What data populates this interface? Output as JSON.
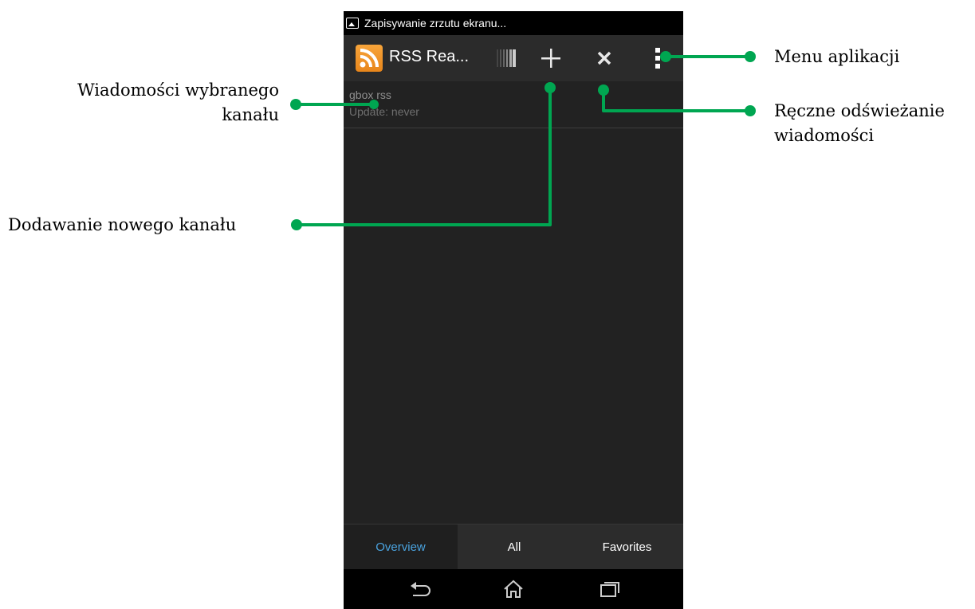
{
  "statusbar": {
    "notification_text": "Zapisywanie zrzutu ekranu..."
  },
  "actionbar": {
    "app_title": "RSS Rea...",
    "add_icon": "plus-icon",
    "refresh_icon": "close-icon",
    "menu_icon": "overflow-menu-icon"
  },
  "feed": {
    "title": "gbox rss",
    "subtitle": "Update: never"
  },
  "tabs": [
    {
      "label": "Overview",
      "active": true
    },
    {
      "label": "All",
      "active": false
    },
    {
      "label": "Favorites",
      "active": false
    }
  ],
  "navbar": {
    "back": "back-icon",
    "home": "home-icon",
    "recents": "recents-icon"
  },
  "annotations": {
    "selected_channel": [
      "Wiadomości wybranego",
      "kanału"
    ],
    "add_channel": "Dodawanie nowego kanału",
    "app_menu": "Menu aplikacji",
    "manual_refresh": [
      "Ręczne odświeżanie",
      "wiadomości"
    ]
  },
  "colors": {
    "annotation_green": "#00a651",
    "accent_blue": "#4aa3df",
    "app_icon_orange": "#f39a2e"
  }
}
